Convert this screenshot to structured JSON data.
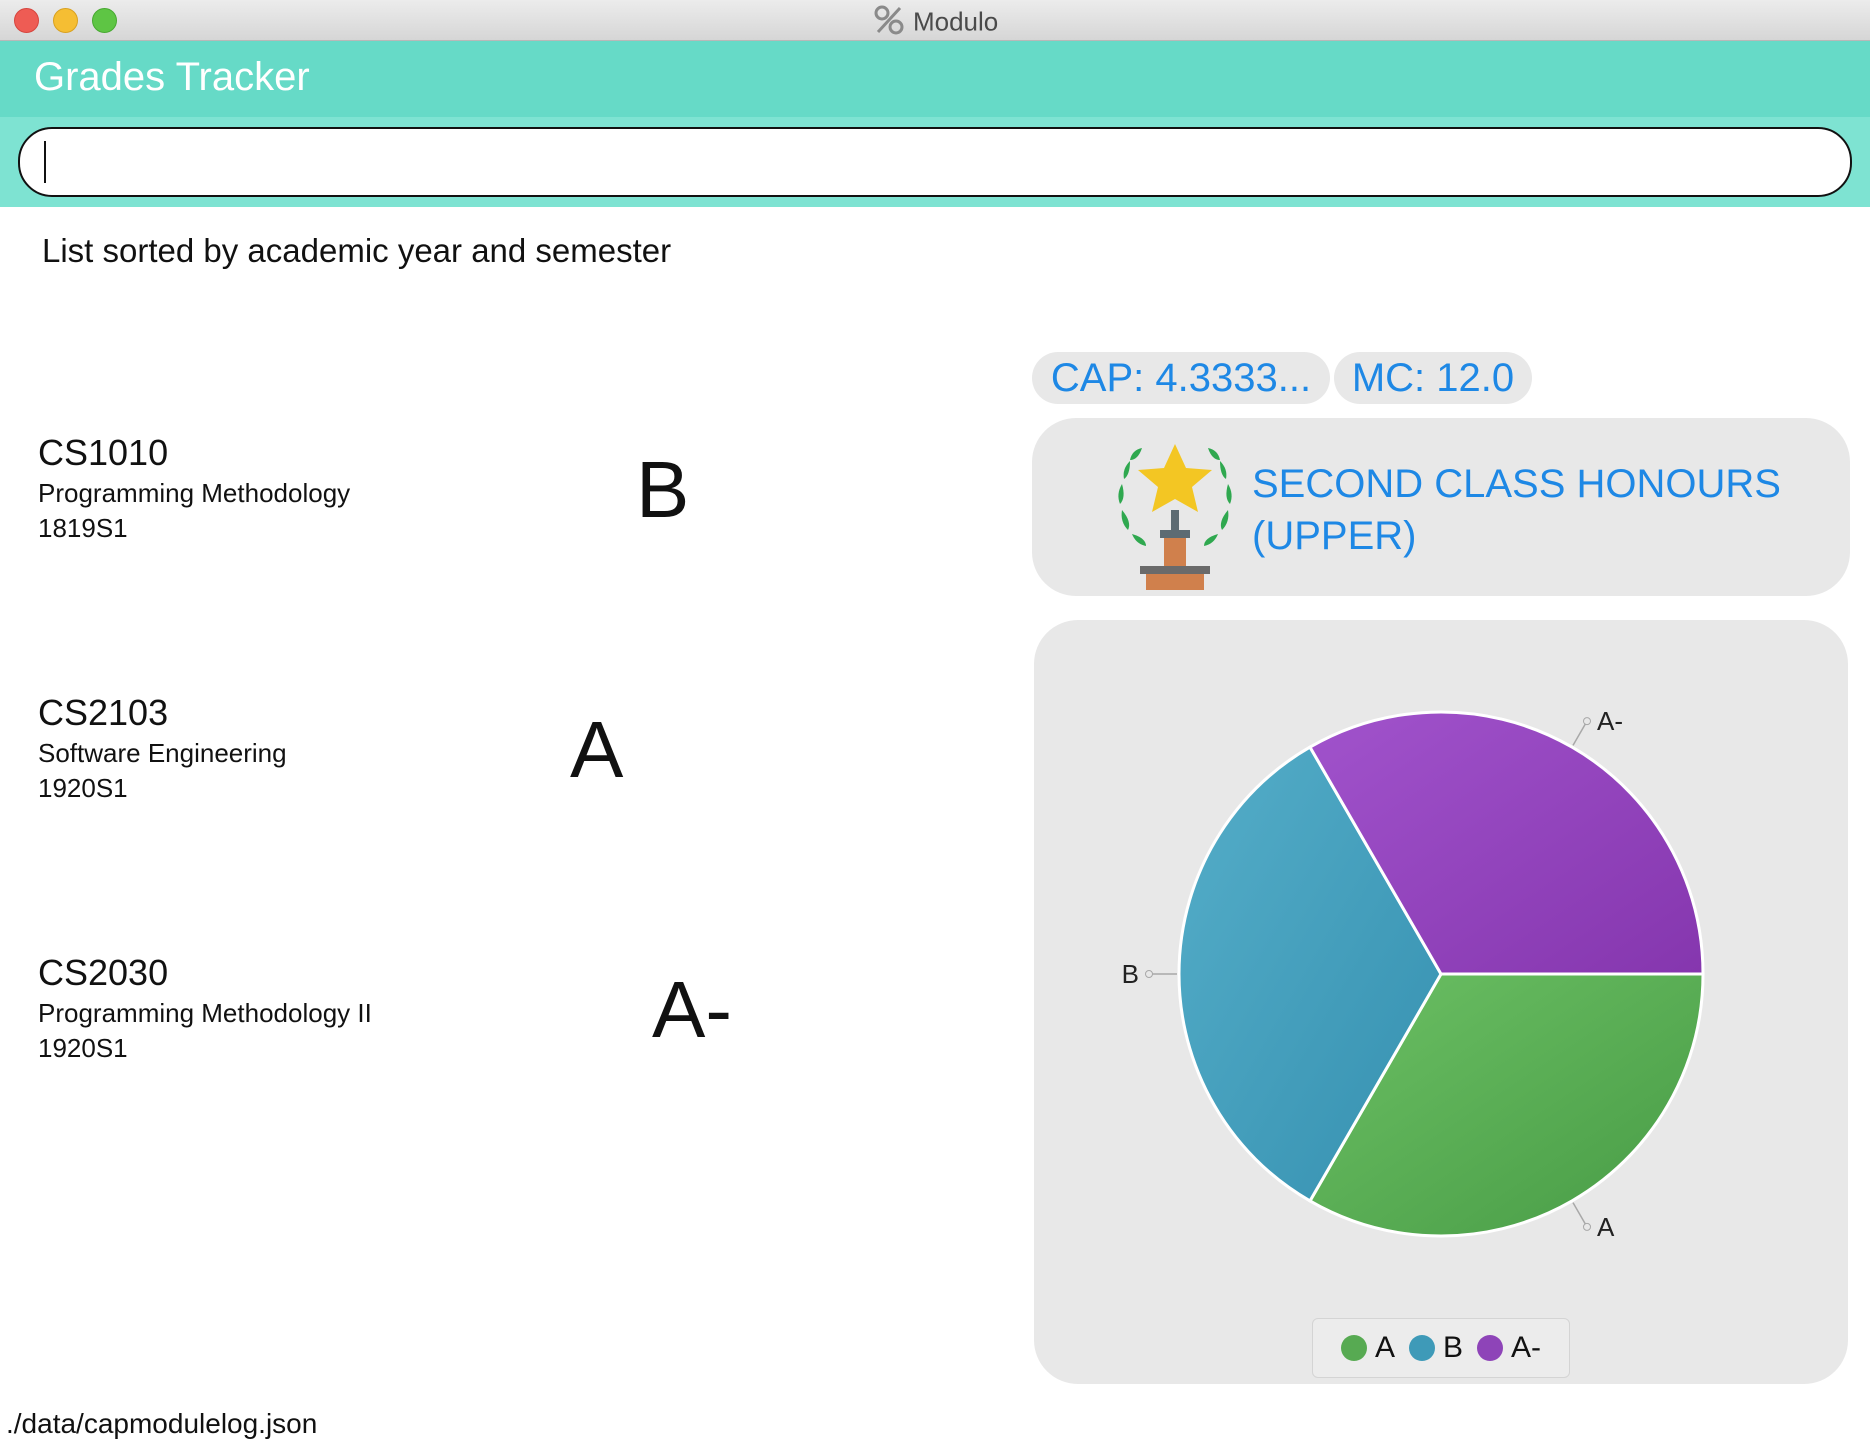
{
  "window": {
    "title": "Modulo",
    "app_icon": "percent-icon"
  },
  "header": {
    "title": "Grades Tracker"
  },
  "command": {
    "value": "",
    "placeholder": ""
  },
  "result_message": "List sorted by academic year and semester",
  "modules": [
    {
      "code": "CS1010",
      "name": "Programming Methodology",
      "semester": "1819S1",
      "grade": "B"
    },
    {
      "code": "CS2103",
      "name": "Software Engineering",
      "semester": "1920S1",
      "grade": "A"
    },
    {
      "code": "CS2030",
      "name": "Programming Methodology II",
      "semester": "1920S1",
      "grade": "A-"
    }
  ],
  "stats": {
    "cap": "CAP: 4.3333...",
    "mc": "MC: 12.0"
  },
  "honours": {
    "line1": "SECOND CLASS HONOURS",
    "line2": "(UPPER)",
    "icon": "trophy-icon"
  },
  "chart_data": {
    "type": "pie",
    "title": "",
    "slices": [
      {
        "label": "A",
        "value": 1,
        "color": "#57aa52"
      },
      {
        "label": "B",
        "value": 1,
        "color": "#3e9ab8"
      },
      {
        "label": "A-",
        "value": 1,
        "color": "#8e44b8"
      }
    ],
    "legend": [
      "A",
      "B",
      "A-"
    ],
    "legend_position": "bottom"
  },
  "status_bar": {
    "path": "./data/capmodulelog.json"
  },
  "colors": {
    "header_bg": "#66dac7",
    "command_bg": "#7ee3d2",
    "accent_text": "#1e88e5",
    "card_bg": "#e8e8e8"
  }
}
